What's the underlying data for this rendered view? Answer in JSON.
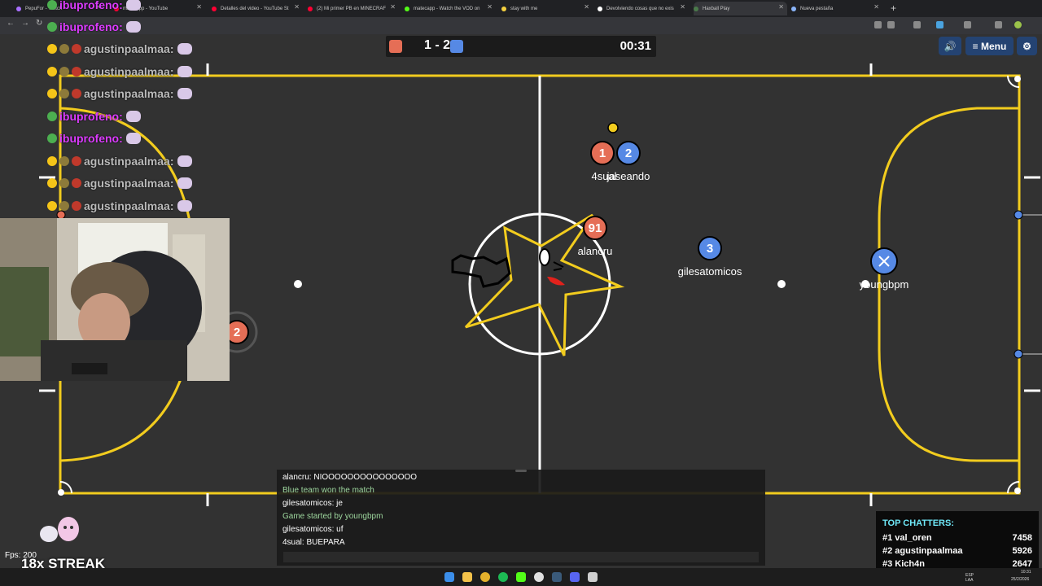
{
  "browser": {
    "tabs": [
      {
        "title": "PepuFor - Twitch",
        "color": "#a970ff"
      },
      {
        "title": "matecapp - YouTube",
        "color": "#ff0033"
      },
      {
        "title": "Detalles del video - YouTube St",
        "color": "#ff0033"
      },
      {
        "title": "(2) Mi primer PB en MINECRAF",
        "color": "#ff0033"
      },
      {
        "title": "matecapp - Watch the VOD on",
        "color": "#53fc18"
      },
      {
        "title": "stay with me",
        "color": "#f4d03f"
      },
      {
        "title": "Devolviendo cosas que no exis",
        "color": "#ffffff"
      },
      {
        "title": "Haxball Play",
        "color": "#4a7a4a"
      },
      {
        "title": "Nueva pestaña",
        "color": "#8ab4f8"
      }
    ],
    "new_tab_symbol": "+",
    "close_symbol": "✕"
  },
  "game": {
    "red_color": "#e56e56",
    "blue_color": "#5689e5",
    "score": "1 - 2",
    "timer": "00:31",
    "menu_label": "≡ Menu",
    "sound_icon": "speaker-icon",
    "settings_icon": "gear-icon",
    "players": [
      {
        "number": "1",
        "team": "red",
        "name": "4sual"
      },
      {
        "number": "2",
        "team": "blue",
        "name": "jaseando"
      },
      {
        "number": "91",
        "team": "red",
        "name": "alancru"
      },
      {
        "number": "3",
        "team": "blue",
        "name": "gilesatomicos"
      },
      {
        "number": "",
        "team": "blue",
        "name": "youngbpm"
      },
      {
        "number": "2",
        "team": "red",
        "name": ""
      }
    ]
  },
  "stream_chat": [
    {
      "user": "ibuprofeno",
      "sep": ":"
    },
    {
      "user": "ibuprofeno",
      "sep": ":"
    },
    {
      "user": "agustinpaalmaa",
      "sep": ":"
    },
    {
      "user": "agustinpaalmaa",
      "sep": ":"
    },
    {
      "user": "agustinpaalmaa",
      "sep": ":"
    },
    {
      "user": "ibuprofeno",
      "sep": ":"
    },
    {
      "user": "ibuprofeno",
      "sep": ":"
    },
    {
      "user": "agustinpaalmaa",
      "sep": ":"
    },
    {
      "user": "agustinpaalmaa",
      "sep": ":"
    },
    {
      "user": "agustinpaalmaa",
      "sep": ":"
    }
  ],
  "game_chat": [
    {
      "text": "alancru: NIOOOOOOOOOOOOOOO",
      "kind": "msg"
    },
    {
      "text": "Blue team won the match",
      "kind": "sys"
    },
    {
      "text": "gilesatomicos: je",
      "kind": "msg"
    },
    {
      "text": "Game started by youngbpm",
      "kind": "sys"
    },
    {
      "text": "gilesatomicos: uf",
      "kind": "msg"
    },
    {
      "text": "4sual: BUEPARA",
      "kind": "msg"
    }
  ],
  "top_chatters": {
    "title": "TOP CHATTERS:",
    "rows": [
      {
        "rank": "#1 val_oren",
        "count": "7458"
      },
      {
        "rank": "#2 agustinpaalmaa",
        "count": "5926"
      },
      {
        "rank": "#3 Kich4n",
        "count": "2647"
      }
    ]
  },
  "overlay": {
    "fps": "Fps: 200",
    "streak": "18x STREAK"
  },
  "taskbar": {
    "lang": "ESP LAA",
    "time": "10:31",
    "date": "25/2/2026"
  }
}
